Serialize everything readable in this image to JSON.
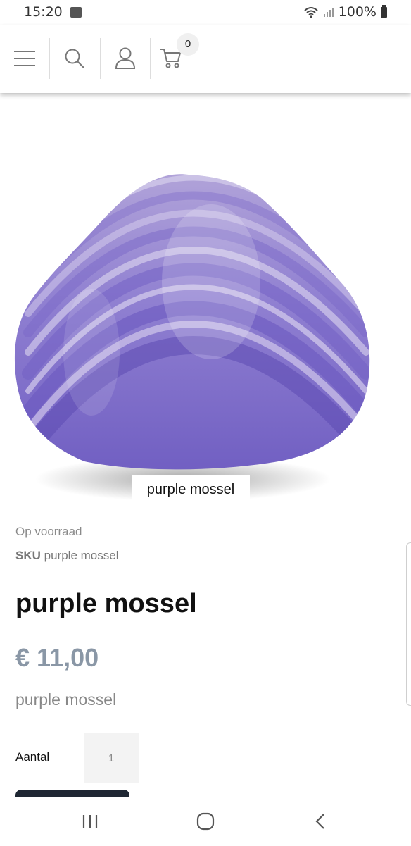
{
  "status_bar": {
    "time": "15:20",
    "battery": "100%",
    "icons": [
      "gallery-icon",
      "wifi-icon",
      "signal-icon",
      "battery-icon"
    ]
  },
  "header": {
    "cart_count": "0",
    "icons": [
      "menu-icon",
      "search-icon",
      "user-icon",
      "cart-icon"
    ]
  },
  "product": {
    "image_caption": "purple mossel",
    "stock_status": "Op voorraad",
    "sku_label": "SKU",
    "sku_value": "purple mossel",
    "title": "purple mossel",
    "price": "€ 11,00",
    "short_description": "purple mossel",
    "quantity_label": "Aantal",
    "quantity_value": "1"
  },
  "navbar": {
    "icons": [
      "recent-apps-icon",
      "home-icon",
      "back-icon"
    ]
  },
  "colors": {
    "shell_purple": "#7b6cc6",
    "price": "#8a97a6",
    "button_dark": "#1f2733"
  }
}
